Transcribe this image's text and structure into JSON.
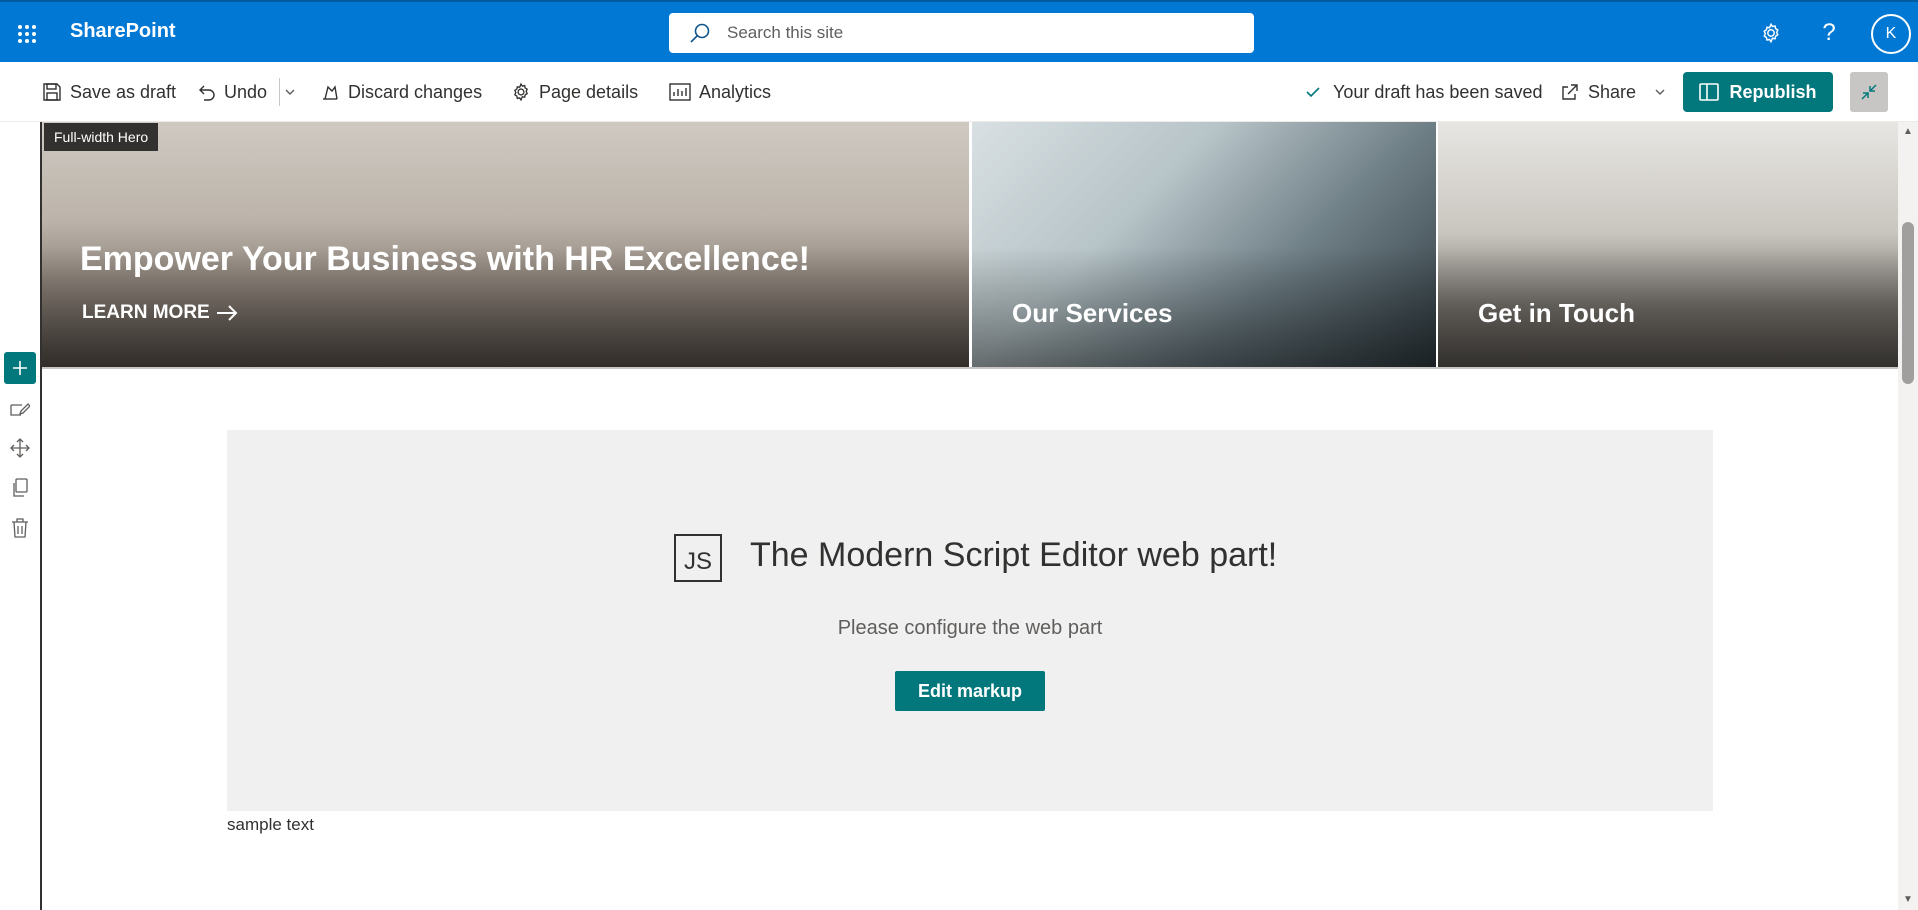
{
  "suite_bar": {
    "app_name": "SharePoint",
    "search_placeholder": "Search this site",
    "avatar_initial": "K",
    "help_glyph": "?"
  },
  "command_bar": {
    "save_draft": "Save as draft",
    "undo": "Undo",
    "discard": "Discard changes",
    "page_details": "Page details",
    "analytics": "Analytics",
    "status": "Your draft has been saved",
    "share": "Share",
    "republish": "Republish"
  },
  "hero": {
    "tag": "Full-width Hero",
    "main_title": "Empower Your Business with HR Excellence!",
    "main_link": "LEARN MORE",
    "tiles": [
      {
        "title": "Our Services"
      },
      {
        "title": "Get in Touch"
      }
    ]
  },
  "script_editor": {
    "logo_text": "JS",
    "title": "The Modern Script Editor web part!",
    "subtitle": "Please configure the web part",
    "button": "Edit markup"
  },
  "sample_text": "sample text",
  "colors": {
    "suite_bar": "#0078d4",
    "accent": "#03787c",
    "placeholder_bg": "#f0f0f0"
  },
  "icons": [
    "waffle-icon",
    "search-icon",
    "settings-icon",
    "help-icon",
    "save-icon",
    "undo-icon",
    "chevron-down-icon",
    "discard-icon",
    "page-details-icon",
    "analytics-icon",
    "checkmark-icon",
    "share-icon",
    "republish-icon",
    "collapse-icon",
    "arrow-right-icon",
    "add-icon",
    "edit-icon",
    "move-icon",
    "duplicate-icon",
    "delete-icon"
  ]
}
